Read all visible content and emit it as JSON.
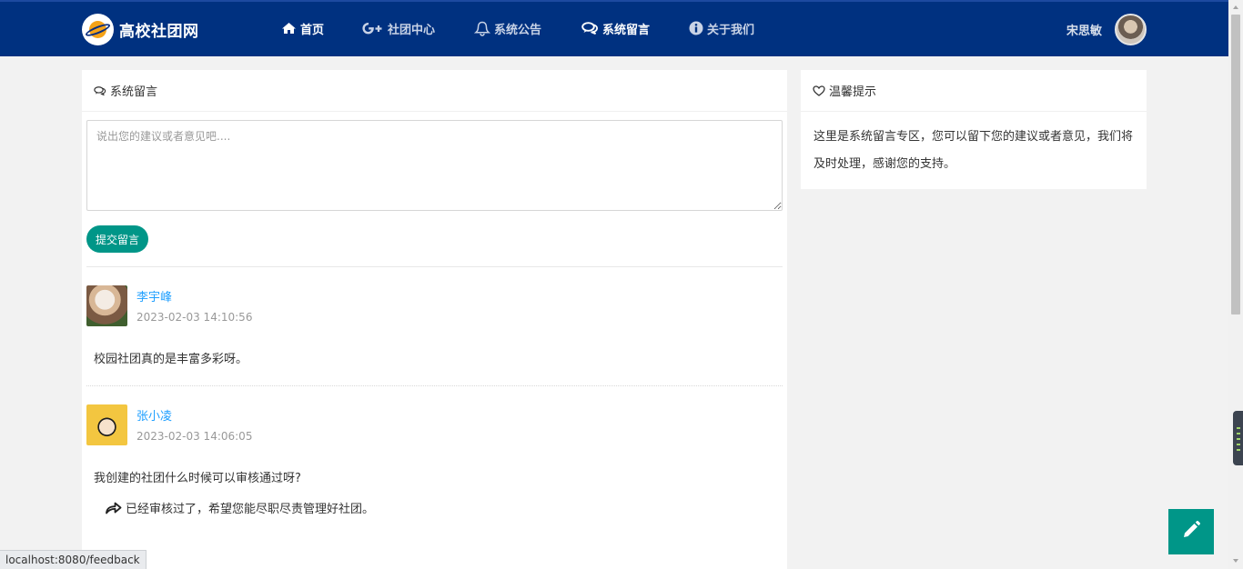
{
  "brand": {
    "title": "高校社团网"
  },
  "nav": {
    "items": [
      {
        "label": "首页",
        "icon": "home-icon"
      },
      {
        "label": "社团中心",
        "icon": "google-plus-icon"
      },
      {
        "label": "系统公告",
        "icon": "bell-icon"
      },
      {
        "label": "系统留言",
        "icon": "comments-icon"
      },
      {
        "label": "关于我们",
        "icon": "info-circle-icon"
      }
    ]
  },
  "user": {
    "name": "宋思敏"
  },
  "feedback": {
    "header": "系统留言",
    "placeholder": "说出您的建议或者意见吧....",
    "submit_label": "提交留言",
    "comments": [
      {
        "name": "李宇峰",
        "time": "2023-02-03 14:10:56",
        "text": "校园社团真的是丰富多彩呀。",
        "avatar_color": "#c49a72"
      },
      {
        "name": "张小凌",
        "time": "2023-02-03 14:06:05",
        "text": "我创建的社团什么时候可以审核通过呀?",
        "reply": "已经审核过了，希望您能尽职尽责管理好社团。",
        "avatar_color": "#f3c640"
      }
    ]
  },
  "tips": {
    "header": "温馨提示",
    "body": "这里是系统留言专区，您可以留下您的建议或者意见，我们将及时处理，感谢您的支持。"
  },
  "status_url": "localhost:8080/feedback",
  "colors": {
    "nav_bg": "#003180",
    "accent": "#009688",
    "link": "#1e9fff"
  }
}
